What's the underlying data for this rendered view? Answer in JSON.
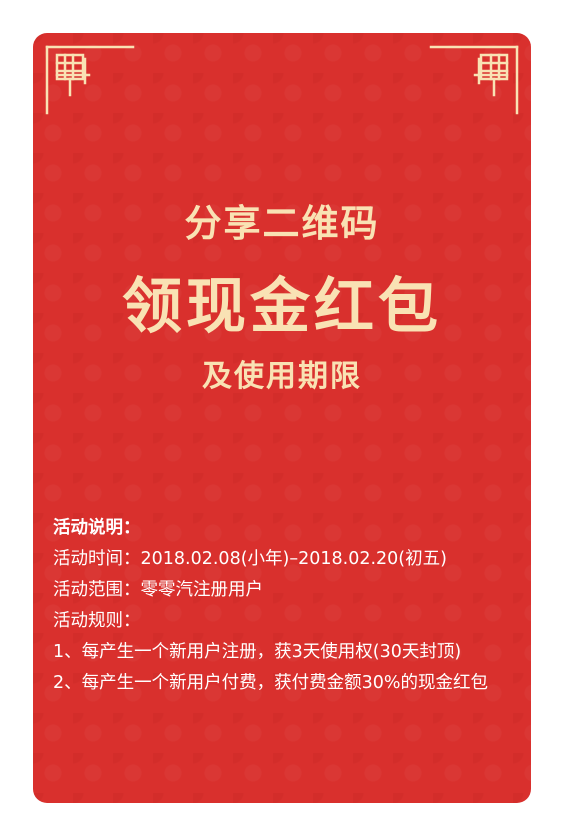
{
  "card": {
    "background_color": "#d9302d",
    "accent_color": "#f9e2b4",
    "hero": {
      "subtitle": "分享二维码",
      "title": "领现金红包",
      "tail": "及使用期限"
    },
    "rules": {
      "heading": "活动说明：",
      "time": "活动时间：2018.02.08(小年)–2018.02.20(初五)",
      "scope": "活动范围：零零汽注册用户",
      "rules_label": "活动规则：",
      "rule1": "1、每产生一个新用户注册，获3天使用权(30天封顶)",
      "rule2": "2、每产生一个新用户付费，获付费金额30%的现金红包"
    },
    "decorations": {
      "left_corner": "chinese-knot-corner-icon",
      "right_corner": "chinese-knot-corner-icon"
    }
  }
}
